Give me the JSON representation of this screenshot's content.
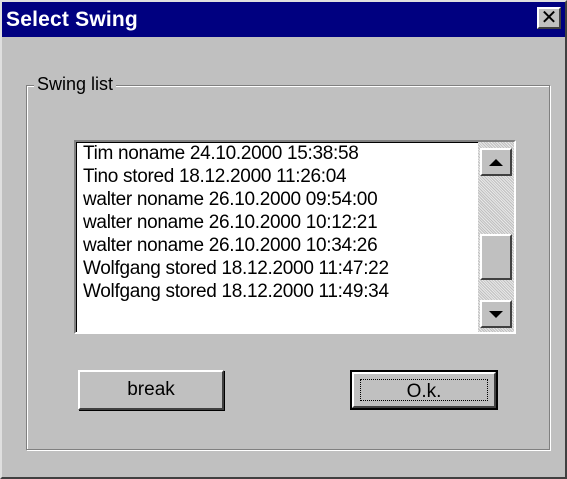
{
  "window": {
    "title": "Select Swing",
    "close_glyph": "✕"
  },
  "group": {
    "label": "Swing list"
  },
  "list": {
    "items": [
      "Tim noname 24.10.2000 15:38:58",
      "Tino stored 18.12.2000 11:26:04",
      "walter noname 26.10.2000 09:54:00",
      "walter noname 26.10.2000 10:12:21",
      "walter noname 26.10.2000 10:34:26",
      "Wolfgang stored 18.12.2000 11:47:22",
      "Wolfgang stored 18.12.2000 11:49:34"
    ]
  },
  "buttons": {
    "break_label": "break",
    "ok_label": "O.k."
  },
  "icons": {
    "close": "close-icon",
    "scroll_up": "arrow-up-icon",
    "scroll_down": "arrow-down-icon"
  },
  "colors": {
    "titlebar": "#000080",
    "face": "#c0c0c0"
  }
}
